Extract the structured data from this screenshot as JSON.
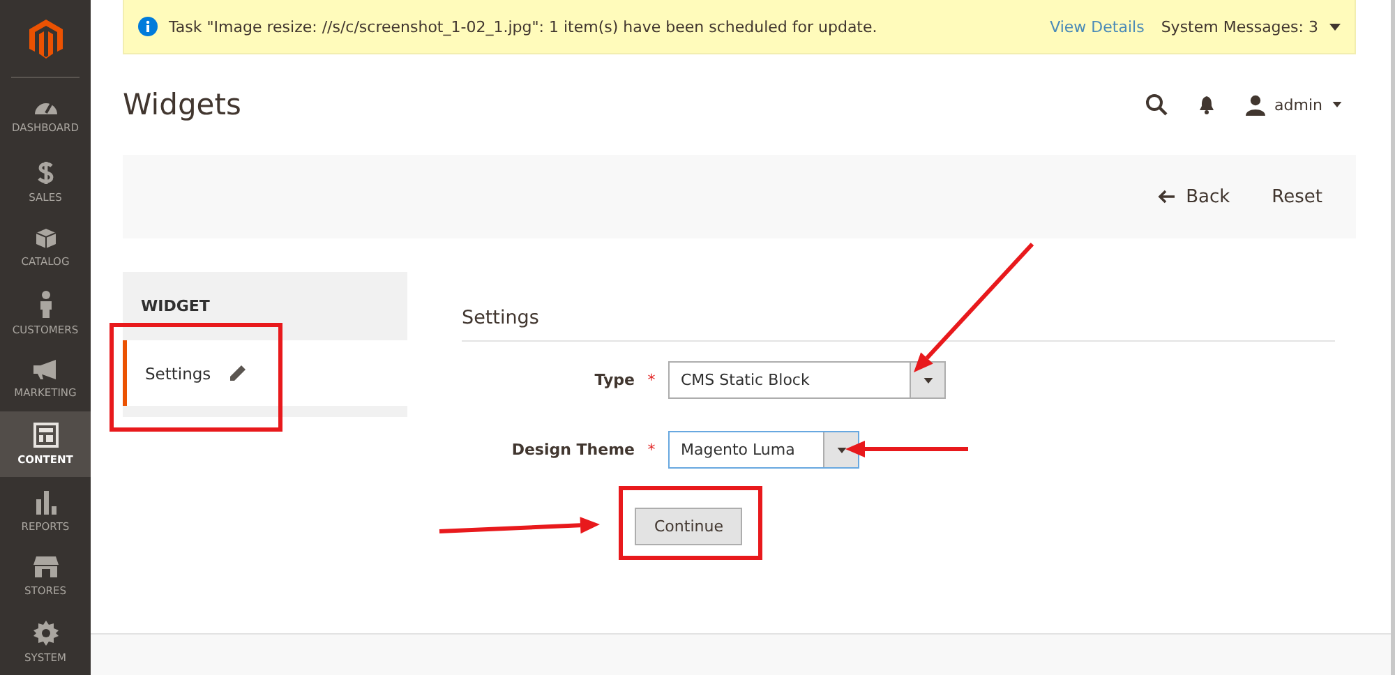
{
  "sidebar": {
    "items": [
      {
        "label": "DASHBOARD",
        "kind": "gauge",
        "selected": false
      },
      {
        "label": "SALES",
        "kind": "dollar",
        "selected": false
      },
      {
        "label": "CATALOG",
        "kind": "box",
        "selected": false
      },
      {
        "label": "CUSTOMERS",
        "kind": "person",
        "selected": false
      },
      {
        "label": "MARKETING",
        "kind": "megaphone",
        "selected": false
      },
      {
        "label": "CONTENT",
        "kind": "layout",
        "selected": true
      },
      {
        "label": "REPORTS",
        "kind": "bars",
        "selected": false
      },
      {
        "label": "STORES",
        "kind": "store",
        "selected": false
      },
      {
        "label": "SYSTEM",
        "kind": "gear",
        "selected": false
      }
    ]
  },
  "notification": {
    "message": "Task \"Image resize: //s/c/screenshot_1-02_1.jpg\": 1 item(s) have been scheduled for update.",
    "link": "View Details",
    "system_messages": "System Messages: 3"
  },
  "header": {
    "title": "Widgets",
    "user": "admin"
  },
  "actions": [
    {
      "label": "Back",
      "kind": "back"
    },
    {
      "label": "Reset",
      "kind": "plain"
    }
  ],
  "side_panel": {
    "heading": "WIDGET",
    "items": [
      {
        "label": "Settings",
        "selected": true
      }
    ]
  },
  "form": {
    "title": "Settings",
    "fields": [
      {
        "label": "Type",
        "required_mark": "*",
        "value": "CMS Static Block",
        "focused": false
      },
      {
        "label": "Design Theme",
        "required_mark": "*",
        "value": "Magento Luma",
        "focused": true
      }
    ],
    "button": "Continue"
  }
}
